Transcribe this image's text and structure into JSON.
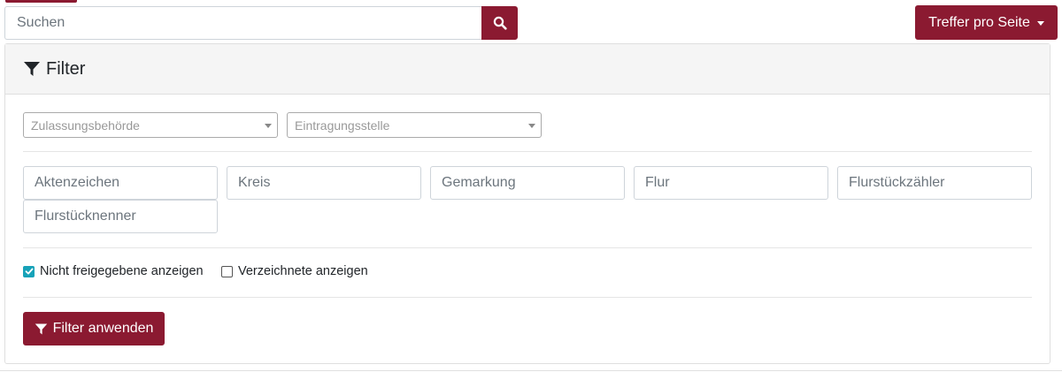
{
  "search": {
    "placeholder": "Suchen",
    "button_icon": "search-icon"
  },
  "results_per_page": {
    "label": "Treffer pro Seite",
    "icon": "caret-down-icon"
  },
  "filter": {
    "title": "Filter",
    "title_icon": "filter-icon",
    "selects": [
      {
        "placeholder": "Zulassungsbehörde"
      },
      {
        "placeholder": "Eintragungsstelle"
      }
    ],
    "fields": [
      {
        "placeholder": "Aktenzeichen"
      },
      {
        "placeholder": "Kreis"
      },
      {
        "placeholder": "Gemarkung"
      },
      {
        "placeholder": "Flur"
      },
      {
        "placeholder": "Flurstückzähler"
      },
      {
        "placeholder": "Flurstücknenner"
      }
    ],
    "checkboxes": [
      {
        "label": "Nicht freigegebene anzeigen",
        "checked": true
      },
      {
        "label": "Verzeichnete anzeigen",
        "checked": false
      }
    ],
    "apply_label": "Filter anwenden"
  },
  "colors": {
    "brand": "#8b1a31",
    "checkbox_accent": "#17a2b8"
  }
}
